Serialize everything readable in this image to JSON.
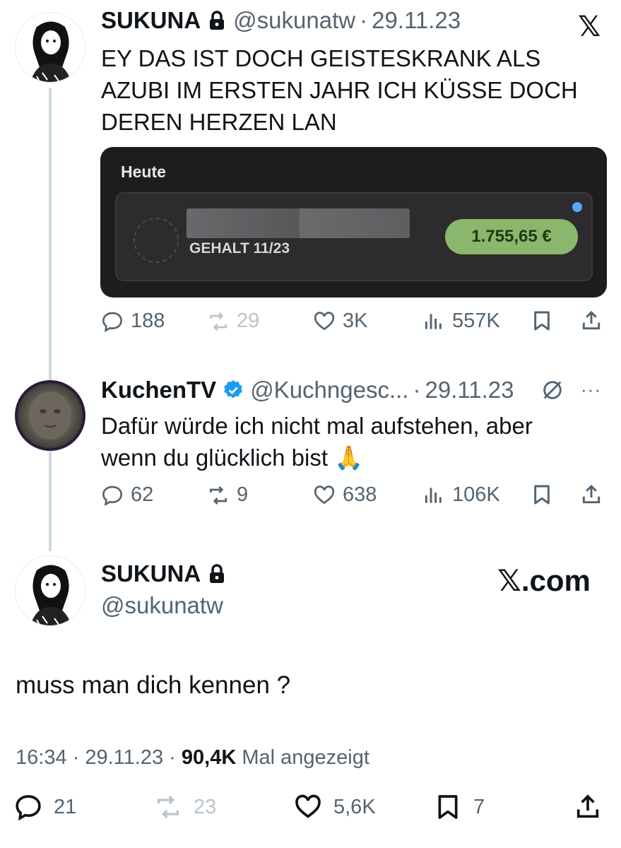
{
  "tweet1": {
    "name": "SUKUNA",
    "handle": "@sukunatw",
    "date": "29.11.23",
    "text_lines": [
      "EY DAS IST DOCH GEISTESKRANK ALS",
      "AZUBI IM ERSTEN JAHR ICH KÜSSE DOCH",
      "DEREN HERZEN LAN"
    ],
    "card": {
      "title": "Heute",
      "subtitle": "GEHALT 11/23",
      "amount": "1.755,65 €"
    },
    "actions": {
      "replies": "188",
      "reposts": "29",
      "likes": "3K",
      "views": "557K"
    }
  },
  "tweet2": {
    "name": "KuchenTV",
    "handle": "@Kuchngesc...",
    "date": "29.11.23",
    "text_lines": [
      "Dafür würde ich nicht mal aufstehen, aber",
      "wenn du glücklich bist 🙏"
    ],
    "actions": {
      "replies": "62",
      "reposts": "9",
      "likes": "638",
      "views": "106K"
    }
  },
  "tweet3": {
    "name": "SUKUNA",
    "handle": "@sukunatw",
    "text": "muss man dich kennen ?",
    "time": "16:34",
    "date": "29.11.23",
    "views_count": "90,4K",
    "views_label": "Mal angezeigt",
    "actions": {
      "replies": "21",
      "reposts": "23",
      "likes": "5,6K",
      "bookmarks": "7"
    }
  },
  "branding": {
    "x_logo": "𝕏",
    "x_com": "𝕏.com"
  },
  "colors": {
    "text": "#0f1419",
    "muted": "#536471",
    "verified": "#1d9bf0",
    "amount_bg": "#8ab76b"
  },
  "icons": [
    "lock-icon",
    "x-logo-icon",
    "verified-badge-icon",
    "reply-icon",
    "repost-icon",
    "like-icon",
    "views-icon",
    "bookmark-icon",
    "share-icon",
    "more-icon",
    "no-reply-icon"
  ]
}
